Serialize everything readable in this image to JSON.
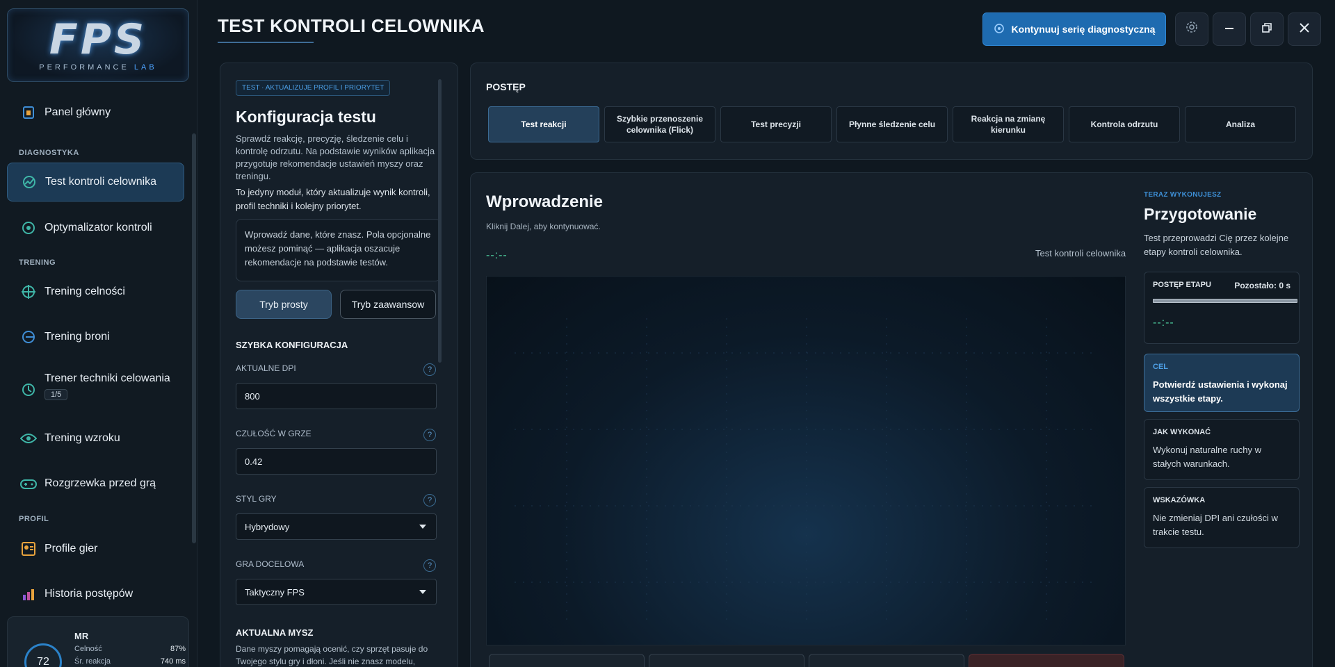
{
  "logo": {
    "main": "FPS",
    "sub_prefix": "PERFORMANCE",
    "sub_accent": "LAB"
  },
  "sidebar": {
    "main_item": "Panel główny",
    "sections": {
      "diagnostics": "DIAGNOSTYKA",
      "training": "TRENING",
      "profile": "PROFIL"
    },
    "items": [
      {
        "label": "Test kontroli celownika",
        "icon": "crosshair-icon"
      },
      {
        "label": "Optymalizator kontroli",
        "icon": "target-icon"
      },
      {
        "label": "Trening celności",
        "icon": "aim-icon"
      },
      {
        "label": "Trening broni",
        "icon": "weapon-icon"
      },
      {
        "label": "Trener techniki celowania",
        "icon": "technique-icon",
        "badge": "1/5"
      },
      {
        "label": "Trening wzroku",
        "icon": "eye-icon"
      },
      {
        "label": "Rozgrzewka przed grą",
        "icon": "gamepad-icon"
      },
      {
        "label": "Profile gier",
        "icon": "profile-icon"
      },
      {
        "label": "Historia postępów",
        "icon": "chart-icon"
      }
    ],
    "user": {
      "initials": "MR",
      "score": "72",
      "stats": [
        {
          "label": "Celność",
          "value": "87%"
        },
        {
          "label": "Śr. reakcja",
          "value": "740 ms"
        }
      ]
    }
  },
  "header": {
    "title": "TEST KONTROLI CELOWNIKA",
    "primary_button": "Kontynuuj serię diagnostyczną"
  },
  "config": {
    "tag": "TEST · AKTUALIZUJE PROFIL I PRIORYTET",
    "title": "Konfiguracja testu",
    "desc": "Sprawdź reakcję, precyzję, śledzenie celu i kontrolę odrzutu. Na podstawie wyników aplikacja przygotuje rekomendacje ustawień myszy oraz treningu.",
    "desc2": "To jedyny moduł, który aktualizuje wynik kontroli, profil techniki i kolejny priorytet.",
    "info": "Wprowadź dane, które znasz. Pola opcjonalne możesz pominąć — aplikacja oszacuje rekomendacje na podstawie testów.",
    "mode_simple": "Tryb prosty",
    "mode_advanced": "Tryb zaawansow",
    "quick_header": "SZYBKA KONFIGURACJA",
    "fields": {
      "dpi_label": "AKTUALNE DPI",
      "dpi_value": "800",
      "sens_label": "CZUŁOŚĆ W GRZE",
      "sens_value": "0.42",
      "style_label": "STYL GRY",
      "style_value": "Hybrydowy",
      "game_label": "GRA DOCELOWA",
      "game_value": "Taktyczny FPS"
    },
    "mouse_header": "AKTUALNA MYSZ",
    "mouse_desc": "Dane myszy pomagają ocenić, czy sprzęt pasuje do Twojego stylu gry i dłoni. Jeśli nie znasz modelu,"
  },
  "progress": {
    "header": "POSTĘP",
    "steps": [
      "Test reakcji",
      "Szybkie przenoszenie celownika (Flick)",
      "Test precyzji",
      "Płynne śledzenie celu",
      "Reakcja na zmianę kierunku",
      "Kontrola odrzutu",
      "Analiza"
    ]
  },
  "main": {
    "title": "Wprowadzenie",
    "subtitle": "Kliknij Dalej, aby kontynuować.",
    "timer": "--:--",
    "module_label": "Test kontroli celownika"
  },
  "now": {
    "label": "TERAZ WYKONUJESZ",
    "title": "Przygotowanie",
    "desc": "Test przeprowadzi Cię przez kolejne etapy kontroli celownika.",
    "stage_label": "POSTĘP ETAPU",
    "remaining": "Pozostało: 0 s",
    "stage_progress_percent": 0,
    "stage_timer": "--:--",
    "goal_label": "CEL",
    "goal_text": "Potwierdź ustawienia i wykonaj wszystkie etapy.",
    "how_label": "JAK WYKONAĆ",
    "how_text": "Wykonuj naturalne ruchy w stałych warunkach.",
    "tip_label": "WSKAZÓWKA",
    "tip_text": "Nie zmieniaj DPI ani czułości w trakcie testu."
  },
  "colors": {
    "accent": "#1e6bb0",
    "timer": "#4fd1a1",
    "bg": "#0f1820"
  }
}
